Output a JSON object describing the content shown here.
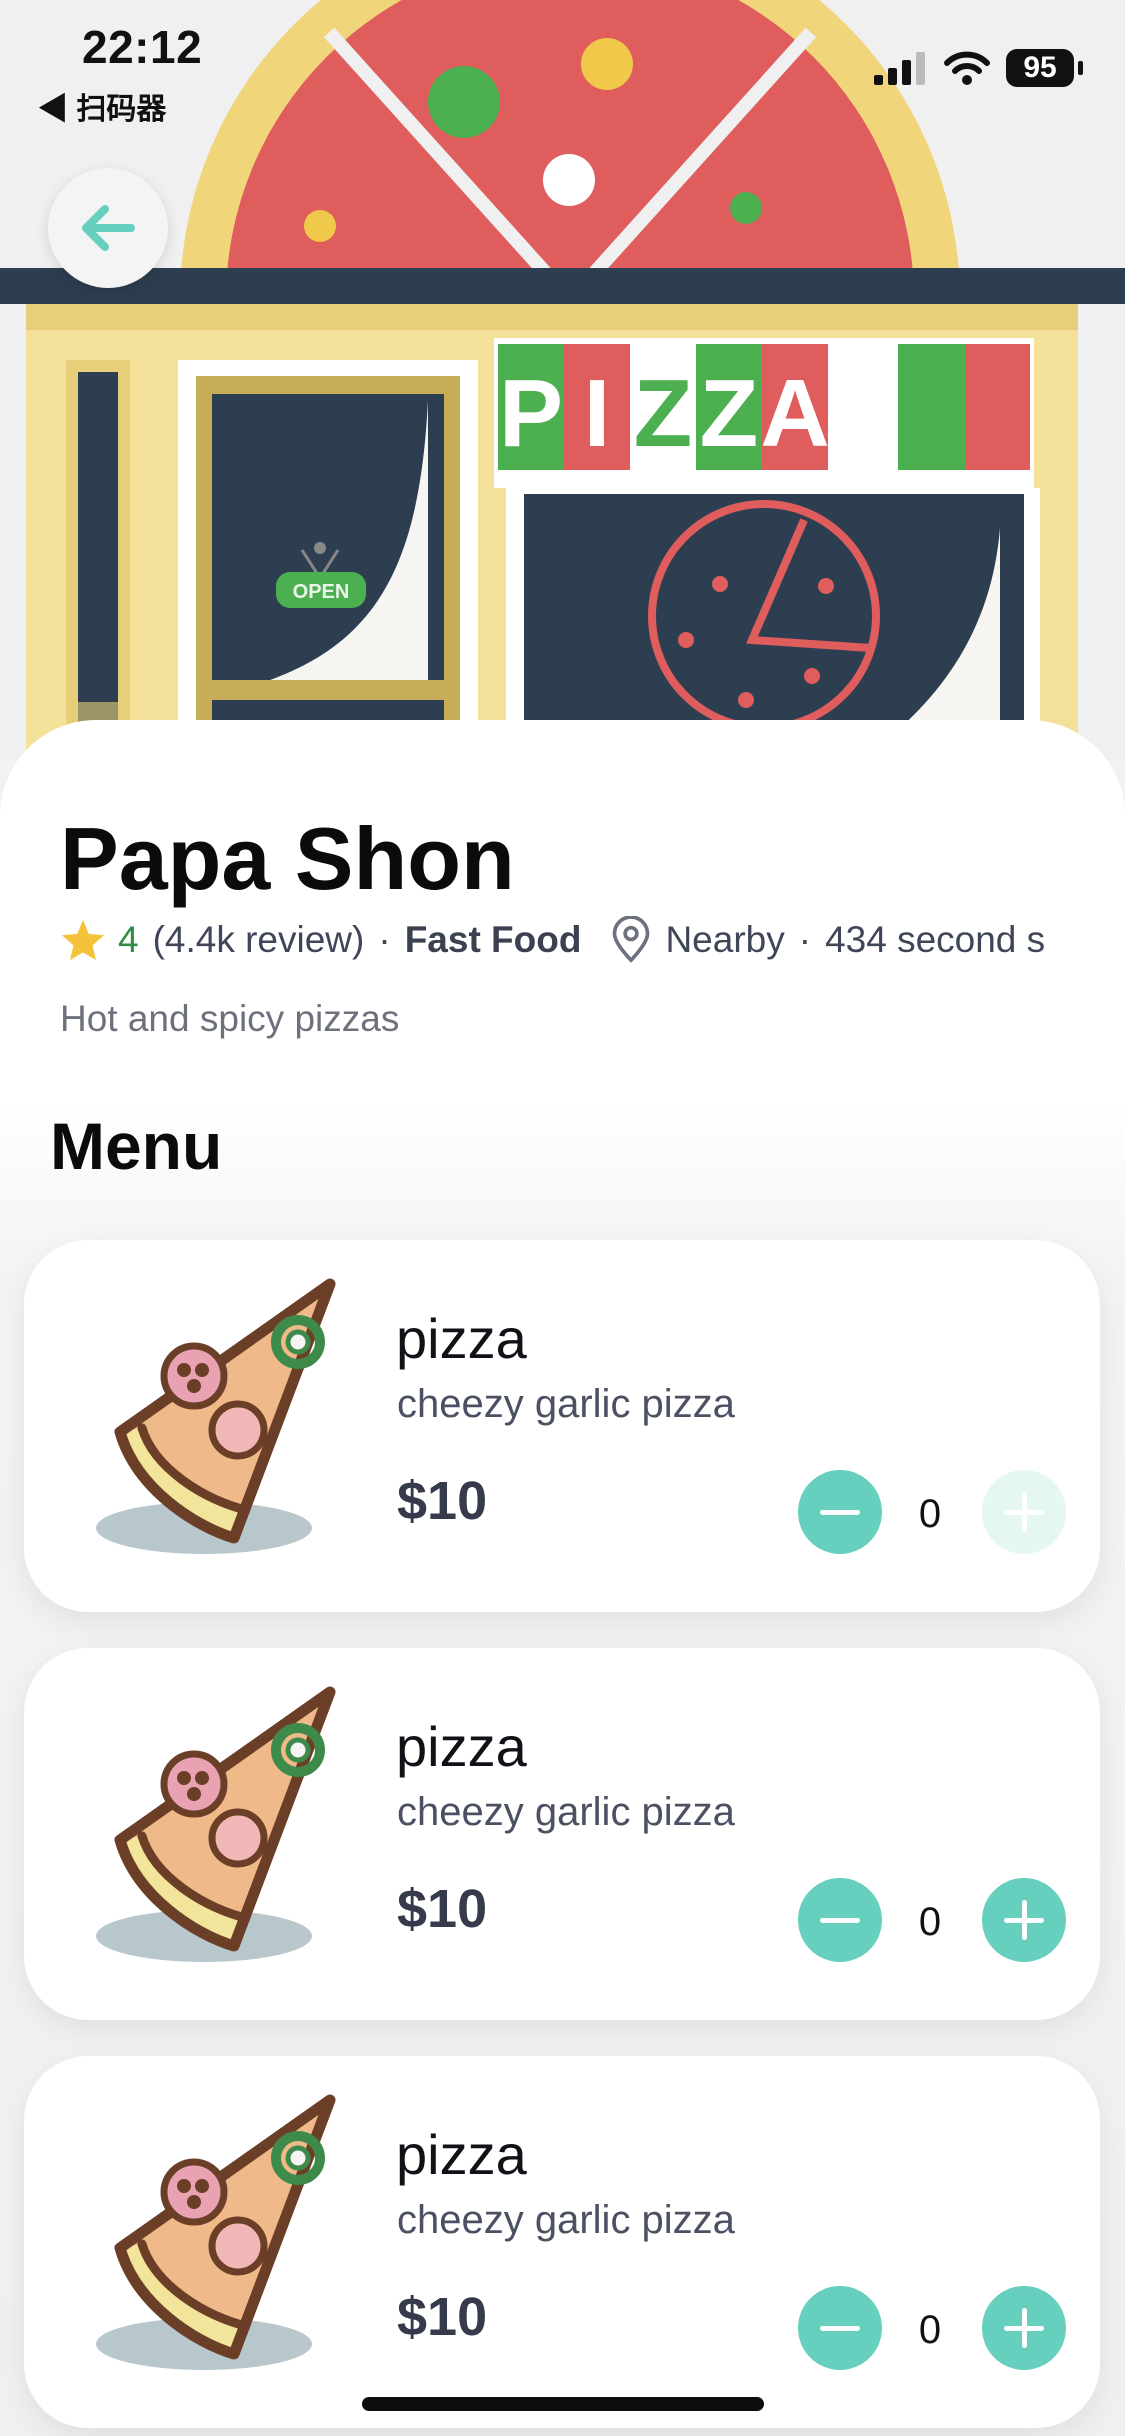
{
  "status_bar": {
    "time": "22:12",
    "back_app": "◀ 扫码器",
    "battery": "95"
  },
  "colors": {
    "accent": "#67cfbd",
    "star": "#f5c33b",
    "rating": "#2f8f45"
  },
  "restaurant": {
    "name": "Papa Shon",
    "rating": "4",
    "reviews": "(4.4k  review)",
    "category": "Fast Food",
    "location": "Nearby",
    "distance": "434 second s",
    "description": "Hot and spicy pizzas"
  },
  "hero": {
    "sign_letters": [
      "P",
      "I",
      "Z",
      "Z",
      "A"
    ],
    "open_sign": "OPEN"
  },
  "menu": {
    "title": "Menu",
    "items": [
      {
        "name": "pizza",
        "description": "cheezy garlic pizza",
        "price": "$10",
        "quantity": "0",
        "plus_enabled": false
      },
      {
        "name": "pizza",
        "description": "cheezy garlic pizza",
        "price": "$10",
        "quantity": "0",
        "plus_enabled": true
      },
      {
        "name": "pizza",
        "description": "cheezy garlic pizza",
        "price": "$10",
        "quantity": "0",
        "plus_enabled": true
      }
    ]
  }
}
